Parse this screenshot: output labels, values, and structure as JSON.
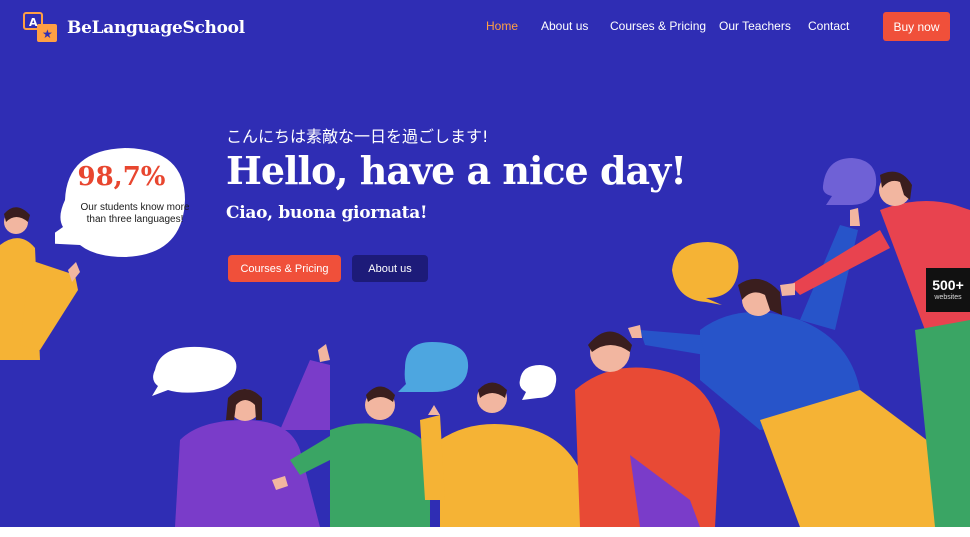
{
  "brand": {
    "name": "BeLanguageSchool"
  },
  "nav": {
    "items": [
      {
        "label": "Home",
        "active": true
      },
      {
        "label": "About us",
        "active": false
      },
      {
        "label": "Courses & Pricing",
        "active": false
      },
      {
        "label": "Our Teachers",
        "active": false
      },
      {
        "label": "Contact",
        "active": false
      }
    ],
    "buy_label": "Buy now"
  },
  "hero": {
    "kicker": "こんにちは素敵な一日を過ごします!",
    "title": "Hello, have a nice day!",
    "subtitle": "Ciao, buona giornata!",
    "cta_primary": "Courses & Pricing",
    "cta_secondary": "About us"
  },
  "stat": {
    "value": "98,7%",
    "caption": "Our students know more than three languages!"
  },
  "badge": {
    "count": "500+",
    "label": "websites"
  },
  "colors": {
    "background": "#2f2db4",
    "accent": "#f0503a",
    "active_nav": "#ff9f43",
    "secondary_button": "#1d1b79"
  }
}
